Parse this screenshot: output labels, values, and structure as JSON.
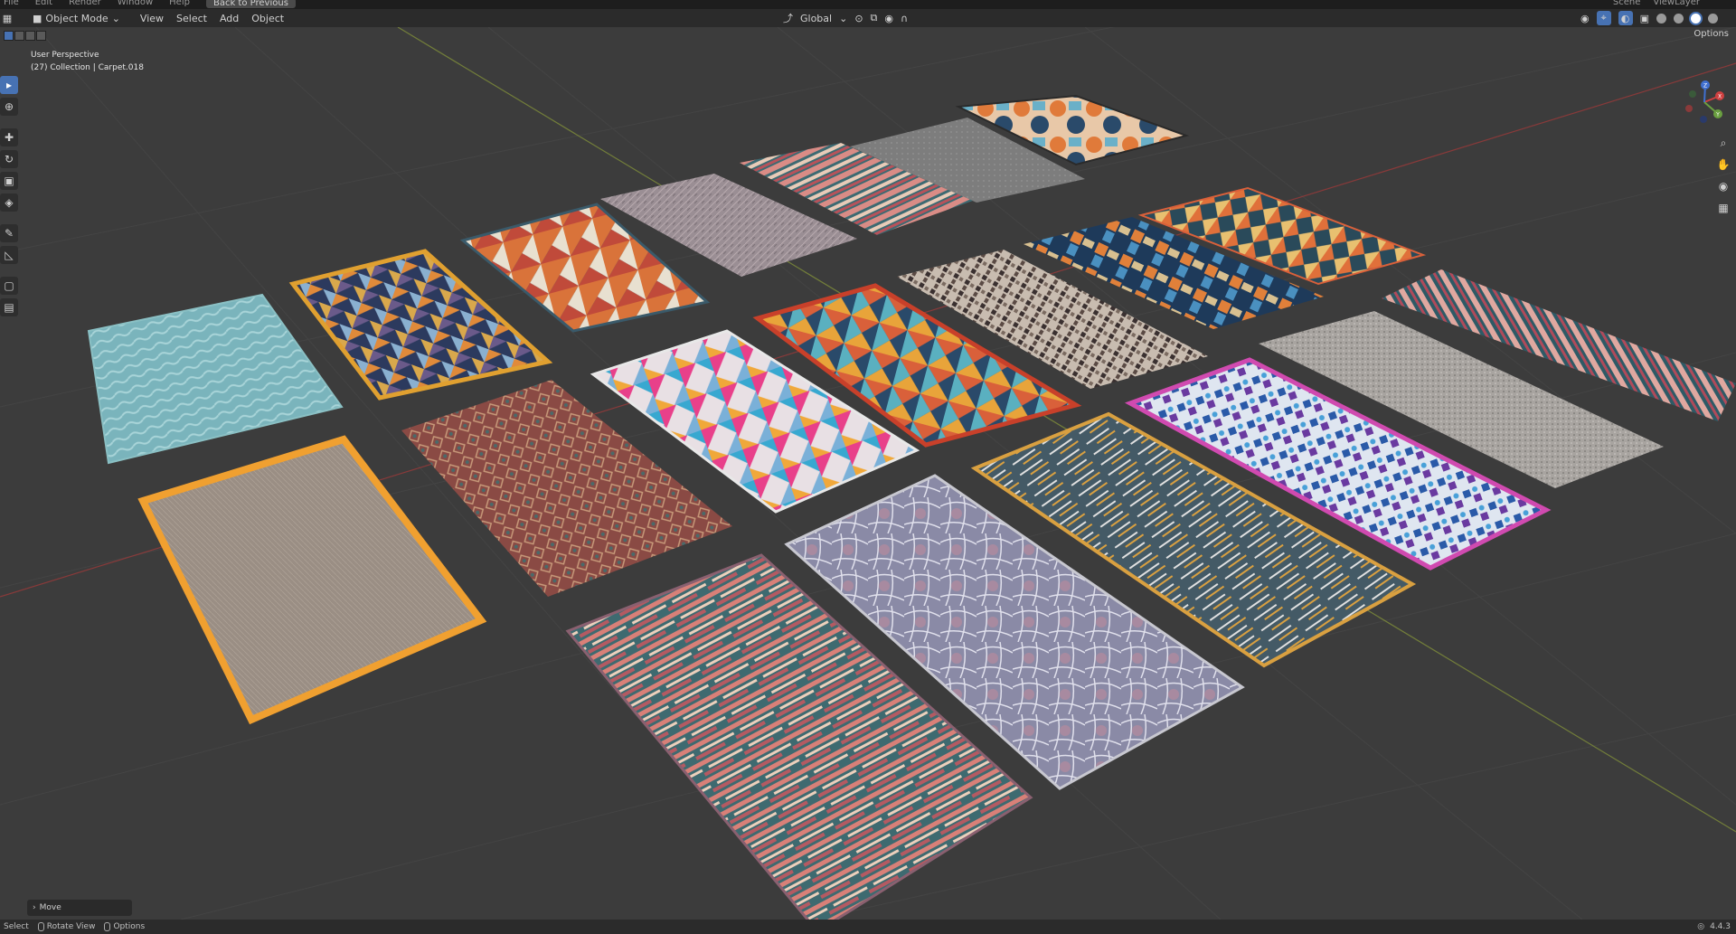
{
  "topbar": {
    "menus": [
      "File",
      "Edit",
      "Render",
      "Window",
      "Help"
    ],
    "back_button": "Back to Previous",
    "scene": "Scene",
    "view_layer": "ViewLayer"
  },
  "header": {
    "mode": "Object Mode",
    "menus": [
      "View",
      "Select",
      "Add",
      "Object"
    ],
    "transform_orientation": "Global"
  },
  "subheader": {
    "options_label": "Options"
  },
  "viewport": {
    "perspective_label": "User Perspective",
    "collection_label": "(27) Collection | Carpet.018"
  },
  "gizmo": {
    "x": "X",
    "y": "Y",
    "z": "Z"
  },
  "toolbar": {
    "tools": [
      "select-box-tool",
      "cursor-tool",
      "move-tool",
      "rotate-tool",
      "scale-tool",
      "transform-tool",
      "annotate-tool",
      "measure-tool",
      "add-cube-tool",
      "add-object-tool"
    ]
  },
  "nav_tools": [
    "zoom-icon",
    "pan-hand-icon",
    "camera-icon",
    "grid-toggle-icon"
  ],
  "operator_panel": {
    "label": "Move"
  },
  "statusbar": {
    "select": "Select",
    "rotate_view": "Rotate View",
    "options": "Options",
    "version": "4.4.3"
  },
  "colors": {
    "accent": "#4772b3",
    "x_axis": "#9b3a3a",
    "y_axis": "#8a9a3a",
    "viewport_bg": "#3c3c3c"
  }
}
